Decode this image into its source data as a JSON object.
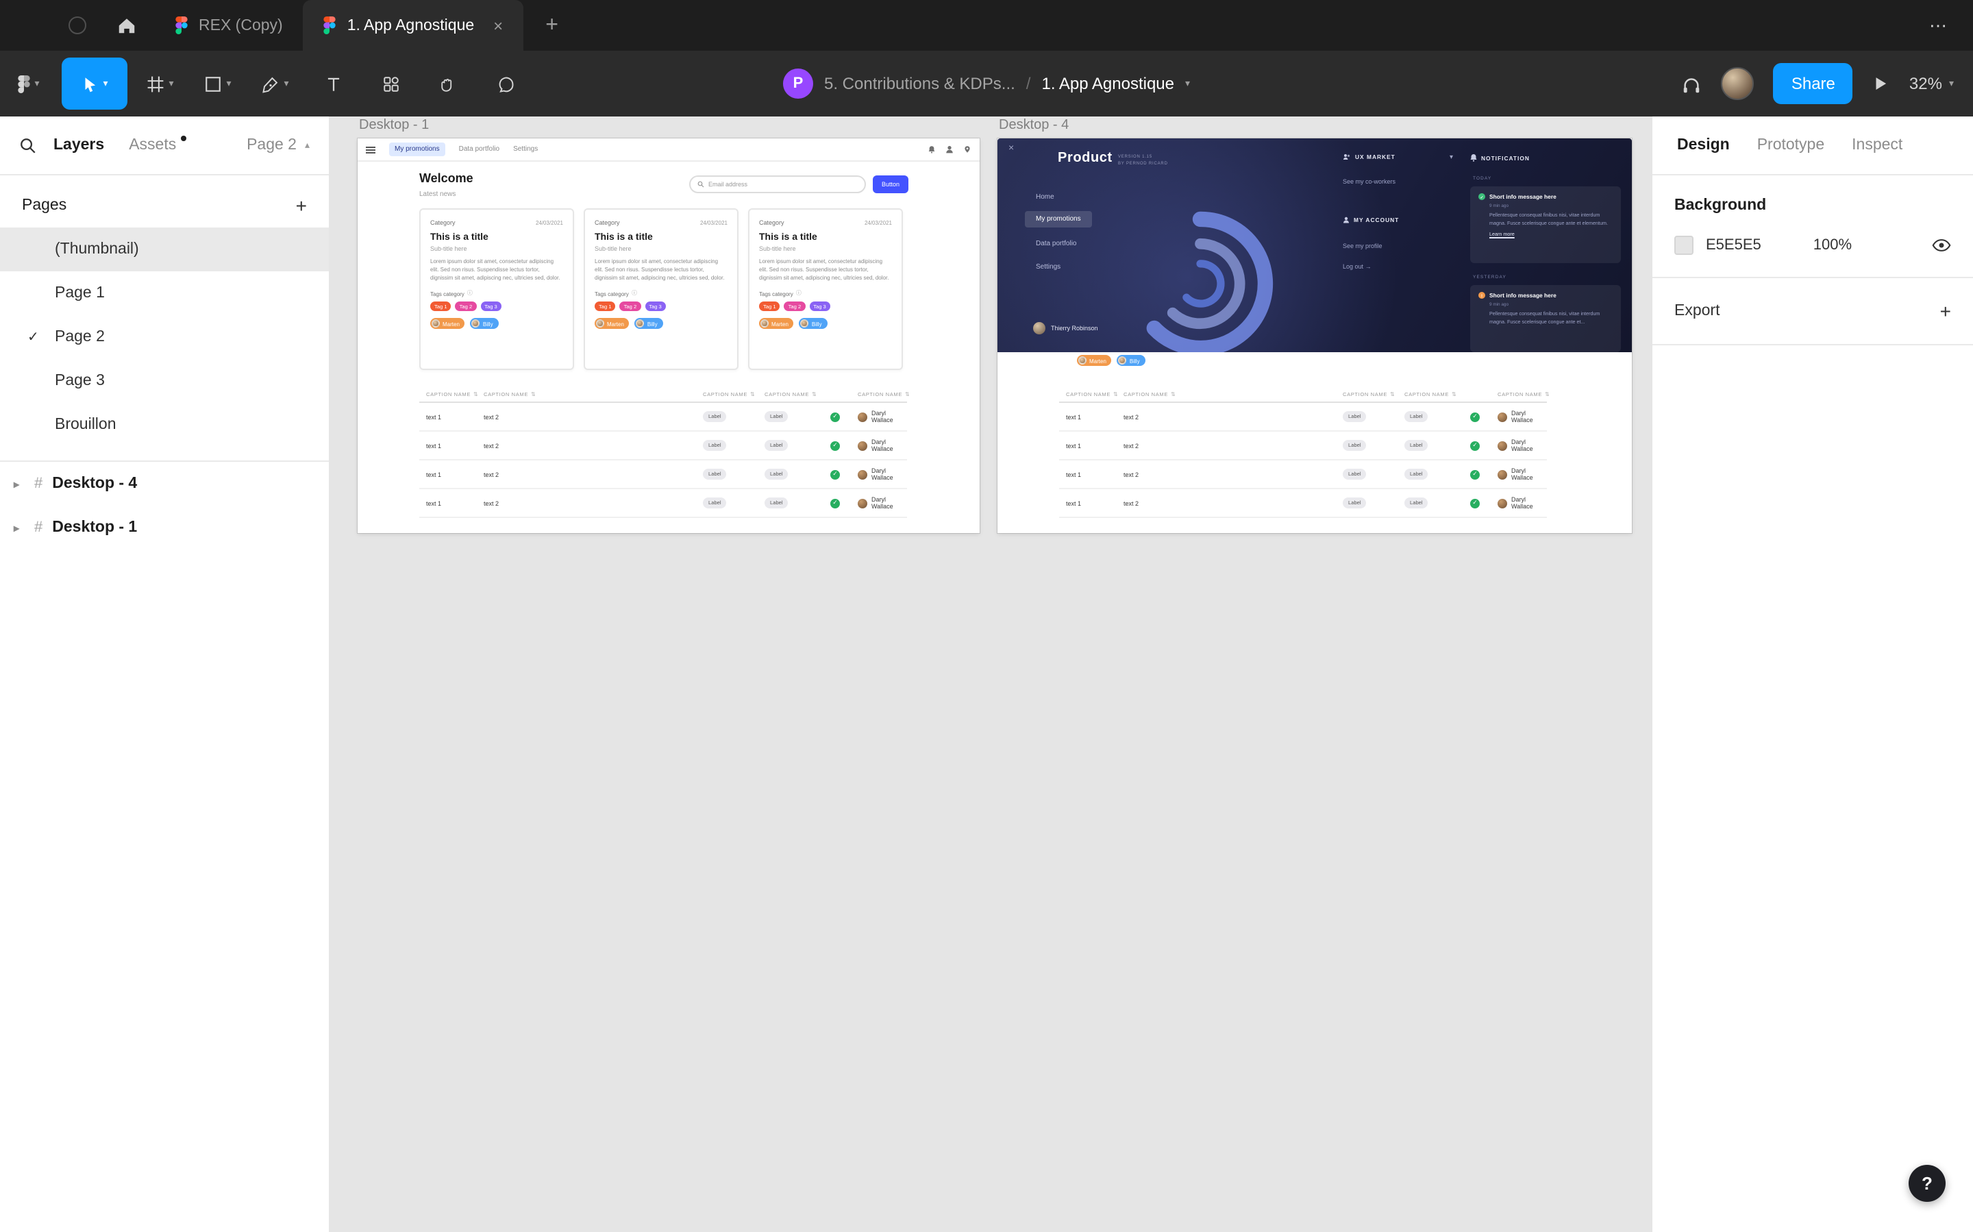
{
  "glyphs": {
    "plus": "+",
    "more": "⋯",
    "close": "×",
    "check": "✓",
    "chevron_down": "▾",
    "chevron_up": "▴",
    "chevron_right": "▸",
    "sort": "⇅",
    "hash": "#",
    "help": "?",
    "info": "ⓘ",
    "arrow_right": "→",
    "exclaim": "!"
  },
  "colors": {
    "figma_blue": "#0D99FF",
    "canvas_background": "#E5E5E5",
    "mock_app_accent": "#4353FF",
    "overlay_background": "#1C2142"
  },
  "tabbar": {
    "tab_rex": "REX (Copy)",
    "tab_current": "1. App Agnostique"
  },
  "toolbar": {
    "project_initial": "P",
    "project_name": "5. Contributions & KDPs...",
    "separator": "/",
    "file_name": "1. App Agnostique",
    "share": "Share",
    "zoom": "32%"
  },
  "left_panel": {
    "layers_tab": "Layers",
    "assets_tab": "Assets",
    "page_selector": "Page 2",
    "pages_title": "Pages",
    "pages": [
      {
        "label": "(Thumbnail)"
      },
      {
        "label": "Page 1"
      },
      {
        "label": "Page 2"
      },
      {
        "label": "Page 3"
      },
      {
        "label": "Brouillon"
      }
    ],
    "layers": [
      {
        "label": "Desktop - 4"
      },
      {
        "label": "Desktop - 1"
      }
    ]
  },
  "right_panel": {
    "design_tab": "Design",
    "prototype_tab": "Prototype",
    "inspect_tab": "Inspect",
    "background_title": "Background",
    "background_hex": "E5E5E5",
    "background_opacity": "100%",
    "export_title": "Export"
  },
  "canvas": {
    "frame1_label": "Desktop - 1",
    "frame2_label": "Desktop - 4"
  },
  "app1": {
    "nav": {
      "item1": "My promotions",
      "item2": "Data portfolio",
      "item3": "Settings"
    },
    "welcome_title": "Welcome",
    "welcome_subtitle": "Latest news",
    "search_placeholder": "Email address",
    "primary_button": "Button",
    "card": {
      "category": "Category",
      "date": "24/03/2021",
      "title": "This is a title",
      "subtitle": "Sub-title here",
      "body": "Lorem ipsum dolor sit amet, consectetur adipiscing elit. Sed non risus. Suspendisse lectus tortor, dignissim sit amet, adipiscing nec, ultricies sed, dolor.",
      "tags_label": "Tags category",
      "tag1": "Tag 1",
      "tag2": "Tag 2",
      "tag3": "Tag 3",
      "member1": "Marten",
      "member2": "Billy"
    },
    "table": {
      "caption": "CAPTION NAME",
      "rows": [
        [
          "text 1",
          "text 2",
          "Label",
          "Label",
          "Daryl Wallace"
        ],
        [
          "text 1",
          "text 2",
          "Label",
          "Label",
          "Daryl Wallace"
        ],
        [
          "text 1",
          "text 2",
          "Label",
          "Label",
          "Daryl Wallace"
        ],
        [
          "text 1",
          "text 2",
          "Label",
          "Label",
          "Daryl Wallace"
        ]
      ]
    }
  },
  "app2": {
    "logo": "Product",
    "version_line1": "VERSION 1.15",
    "version_line2": "BY PERNOD RICARD",
    "menu": {
      "item1": "Home",
      "item2": "My promotions",
      "item3": "Data portfolio",
      "item4": "Settings"
    },
    "user_name": "Thierry Robinson",
    "ux_market_title": "UX MARKET",
    "coworkers_link": "See my co-workers",
    "account_title": "MY ACCOUNT",
    "profile_link": "See my profile",
    "logout_link": "Log out",
    "notification_title": "NOTIFICATION",
    "today_label": "TODAY",
    "yesterday_label": "YESTERDAY",
    "notif1": {
      "title": "Short info message here",
      "time": "9 min ago",
      "body": "Pellentesque consequat finibus nisi, vitae interdum magna. Fusce scelerisque congue ante et elementum.",
      "link": "Learn more"
    },
    "notif2": {
      "title": "Short info message here",
      "time": "9 min ago",
      "body": "Pellentesque consequat finibus nisi, vitae interdum magna. Fusce scelerisque congue ante et..."
    },
    "member1": "Marten",
    "member2": "Billy",
    "table": {
      "caption": "CAPTION NAME",
      "rows": [
        [
          "text 1",
          "text 2",
          "Label",
          "Label",
          "Daryl Wallace"
        ],
        [
          "text 1",
          "text 2",
          "Label",
          "Label",
          "Daryl Wallace"
        ],
        [
          "text 1",
          "text 2",
          "Label",
          "Label",
          "Daryl Wallace"
        ],
        [
          "text 1",
          "text 2",
          "Label",
          "Label",
          "Daryl Wallace"
        ]
      ]
    }
  }
}
